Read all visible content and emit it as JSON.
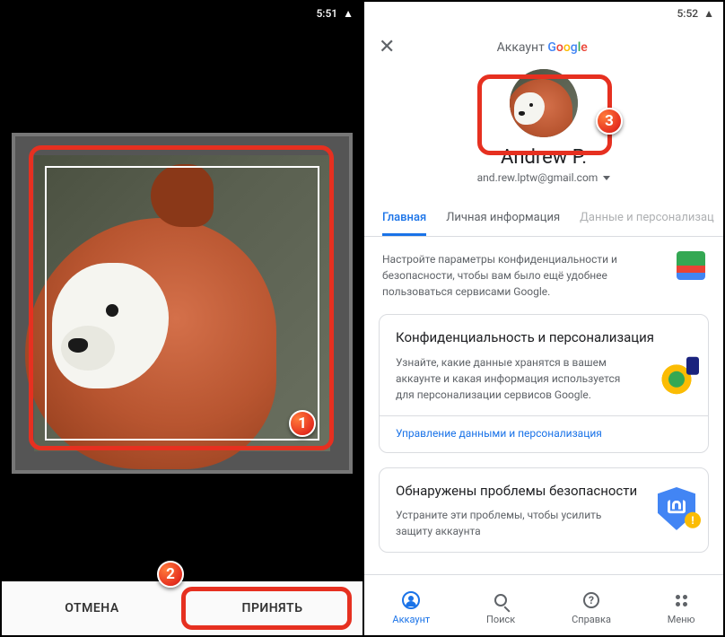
{
  "left_phone": {
    "status_time": "5:51",
    "cancel_label": "ОТМЕНА",
    "accept_label": "ПРИНЯТЬ"
  },
  "right_phone": {
    "status_time": "5:52",
    "header_prefix": "Аккаунт ",
    "user_name": "Andrew P.",
    "user_email": "and.rew.lptw@gmail.com",
    "tabs": {
      "home": "Главная",
      "personal": "Личная информация",
      "data": "Данные и персонализац"
    },
    "intro": "Настройте параметры конфиденциальности и безопасности, чтобы вам было ещё удобнее пользоваться сервисами Google.",
    "card1": {
      "title": "Конфиденциальность и персонализация",
      "desc": "Узнайте, какие данные хранятся в вашем аккаунте и какая информация используется для персонализации сервисов Google.",
      "link": "Управление данными и персонализация"
    },
    "card2": {
      "title": "Обнаружены проблемы безопасности",
      "desc": "Устраните эти проблемы, чтобы усилить защиту аккаунта"
    },
    "nav": {
      "account": "Аккаунт",
      "search": "Поиск",
      "help": "Справка",
      "menu": "Меню"
    }
  },
  "badges": {
    "b1": "1",
    "b2": "2",
    "b3": "3"
  }
}
